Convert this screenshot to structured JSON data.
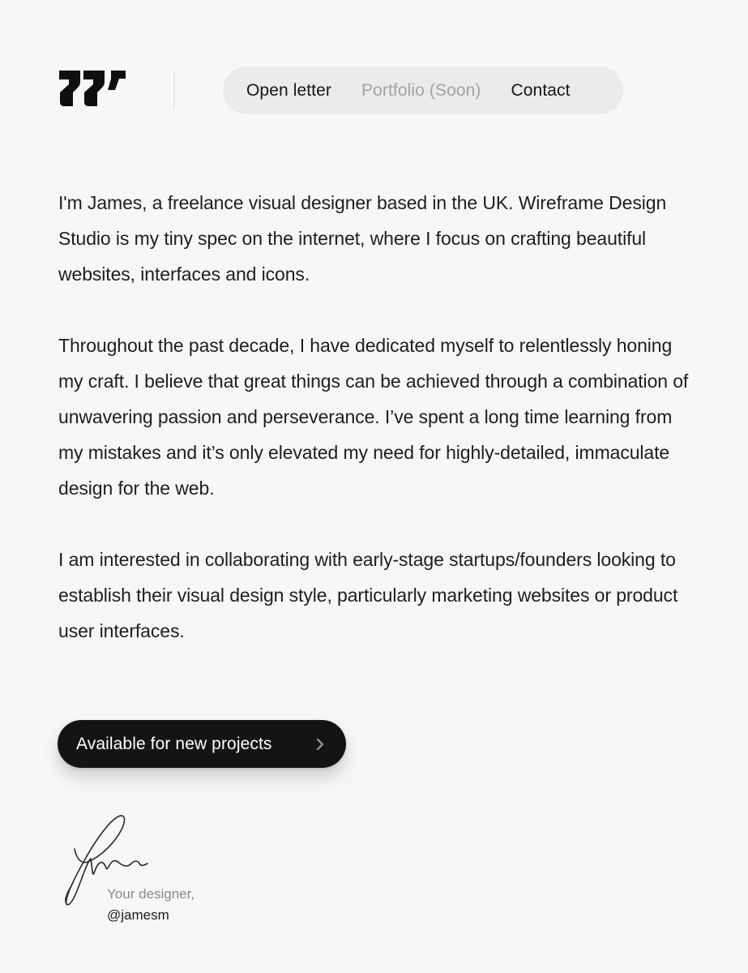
{
  "brand": {
    "logo_icon": "wireframe-logo-icon"
  },
  "nav": {
    "items": [
      {
        "label": "Open letter",
        "state": "active"
      },
      {
        "label": "Portfolio (Soon)",
        "state": "disabled"
      },
      {
        "label": "Contact",
        "state": "active"
      }
    ]
  },
  "letter": {
    "paragraphs": [
      "I'm James, a freelance visual designer based in the UK. Wireframe Design Studio is my tiny spec on the internet, where I focus on crafting beautiful websites, interfaces and icons.",
      "Throughout the past decade, I have dedicated myself to relentlessly honing my craft. I believe that great things can be achieved through a combination of unwavering passion and perseverance. I’ve spent a long time learning from my mistakes and it’s only elevated my need for highly-detailed, immaculate design for the web.",
      "I am interested in collaborating with early-stage startups/founders looking to establish their visual design style, particularly marketing websites or product user interfaces."
    ]
  },
  "cta": {
    "label": "Available for new projects",
    "icon": "chevron-right-icon"
  },
  "signoff": {
    "signature_icon": "signature-icon",
    "caption": "Your designer,",
    "handle": "@jamesm"
  },
  "colors": {
    "background": "#f7f7f7",
    "nav_background": "#ebebeb",
    "text": "#1e1e1e",
    "muted_text": "#a3a3a3",
    "cta_background": "#141414",
    "cta_text": "#ffffff"
  }
}
